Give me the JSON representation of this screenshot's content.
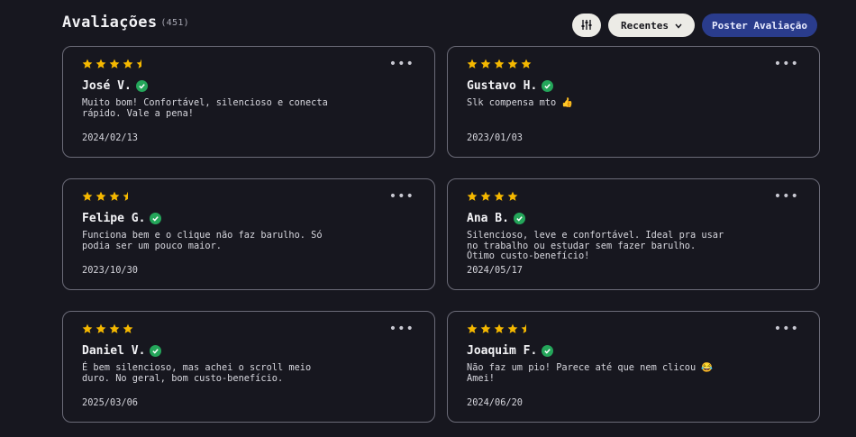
{
  "header": {
    "title": "Avaliações",
    "count": "(451)",
    "filter_icon": "sliders-icon",
    "sort_label": "Recentes",
    "sort_icon": "chevron-down-icon",
    "post_label": "Poster Avaliação"
  },
  "colors": {
    "background": "#17171f",
    "star": "#f5b800",
    "verified": "#24a65a",
    "primary_button": "#2a3c8c",
    "pill_button": "#ecebe6"
  },
  "more_icon": "ellipsis-icon",
  "reviews": [
    {
      "rating": 4.5,
      "author": "José V.",
      "text": "Muito bom! Confortável, silencioso e conecta\nrápido. Vale a pena!",
      "date": "2024/02/13",
      "verified": true
    },
    {
      "rating": 5,
      "author": "Gustavo H.",
      "text": "Slk compensa mto 👍",
      "date": "2023/01/03",
      "verified": true
    },
    {
      "rating": 3.5,
      "author": "Felipe G.",
      "text": "Funciona bem e o clique não faz barulho. Só\npodia ser um pouco maior.",
      "date": "2023/10/30",
      "verified": true
    },
    {
      "rating": 4,
      "author": "Ana B.",
      "text": "Silencioso, leve e confortável. Ideal pra usar\nno trabalho ou estudar sem fazer barulho.\nÓtimo custo-benefício!",
      "date": "2024/05/17",
      "verified": true
    },
    {
      "rating": 4,
      "author": "Daniel V.",
      "text": "É bem silencioso, mas achei o scroll meio\nduro. No geral, bom custo-benefício.",
      "date": "2025/03/06",
      "verified": true
    },
    {
      "rating": 4.5,
      "author": "Joaquim F.",
      "text": "Não faz um pio! Parece até que nem clicou 😂\nAmei!",
      "date": "2024/06/20",
      "verified": true
    }
  ]
}
